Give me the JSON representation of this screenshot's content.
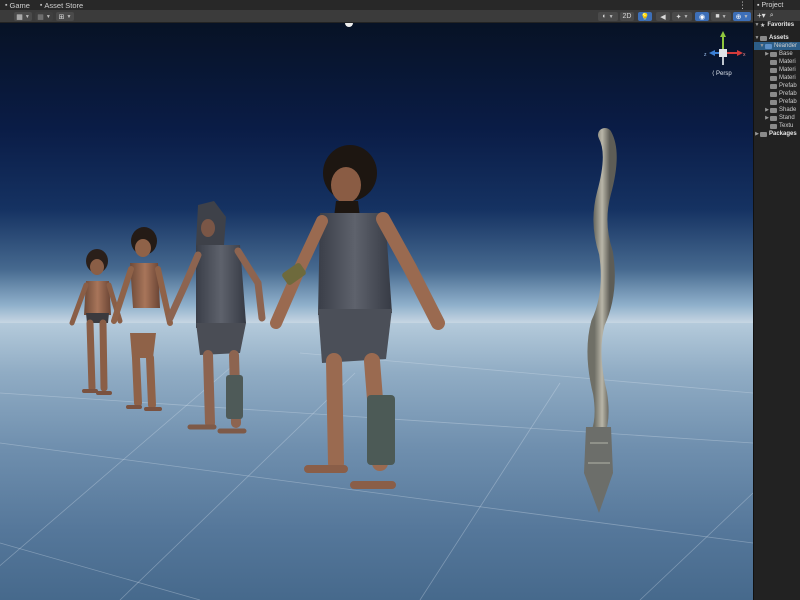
{
  "tabs": [
    {
      "label": "Game",
      "icon": "gamepad-icon"
    },
    {
      "label": "Asset Store",
      "icon": "store-icon"
    }
  ],
  "toolbar": {
    "view_2d_label": "2D",
    "buttons": [
      "transform-tools",
      "grid-snap",
      "pivot-mode",
      "shading-mode",
      "2d-toggle",
      "lighting-toggle",
      "audio-toggle",
      "effects-toggle",
      "scene-visibility",
      "camera-settings",
      "gizmos"
    ]
  },
  "viewport": {
    "projection_label": "Persp",
    "gizmo_axes": [
      "x",
      "y",
      "z"
    ]
  },
  "project": {
    "title": "Project",
    "search_icon": "search-icon",
    "favorites_label": "Favorites",
    "assets_label": "Assets",
    "asset_root": "Neander",
    "folders": [
      "Base",
      "Materi",
      "Materi",
      "Materi",
      "Prefab",
      "Prefab",
      "Prefab",
      "Shade",
      "Stand",
      "Textu"
    ],
    "packages_label": "Packages"
  },
  "colors": {
    "editor_dark": "#191919",
    "toolbar": "#3b3b3b",
    "accent_blue": "#3d6fb8",
    "selection": "#2c5d87",
    "gizmo_x": "#d33b3b",
    "gizmo_y": "#8fc73e",
    "gizmo_z": "#3b7fd3"
  }
}
